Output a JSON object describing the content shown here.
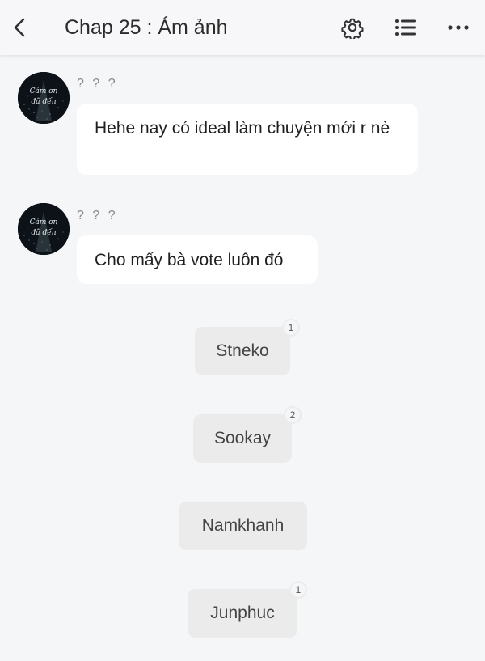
{
  "header": {
    "title": "Chap 25 : Ám ảnh",
    "back_icon": "chevron-left-icon",
    "settings_icon": "gear-icon",
    "list_icon": "list-icon",
    "more_icon": "more-horizontal-icon"
  },
  "messages": [
    {
      "sender": "? ? ?",
      "text": "Hehe nay có ideal làm chuyện mới r nè",
      "avatar_text": "Cảm ơn đã đến"
    },
    {
      "sender": "? ? ?",
      "text": "Cho mấy bà vote luôn đó",
      "avatar_text": "Cảm ơn đã đến"
    }
  ],
  "choices": [
    {
      "label": "Stneko",
      "count": "1"
    },
    {
      "label": "Sookay",
      "count": "2"
    },
    {
      "label": "Namkhanh",
      "count": ""
    },
    {
      "label": "Junphuc",
      "count": "1"
    }
  ],
  "colors": {
    "background": "#f5f6f8",
    "bubble": "#ffffff",
    "choice": "#ebebeb"
  }
}
